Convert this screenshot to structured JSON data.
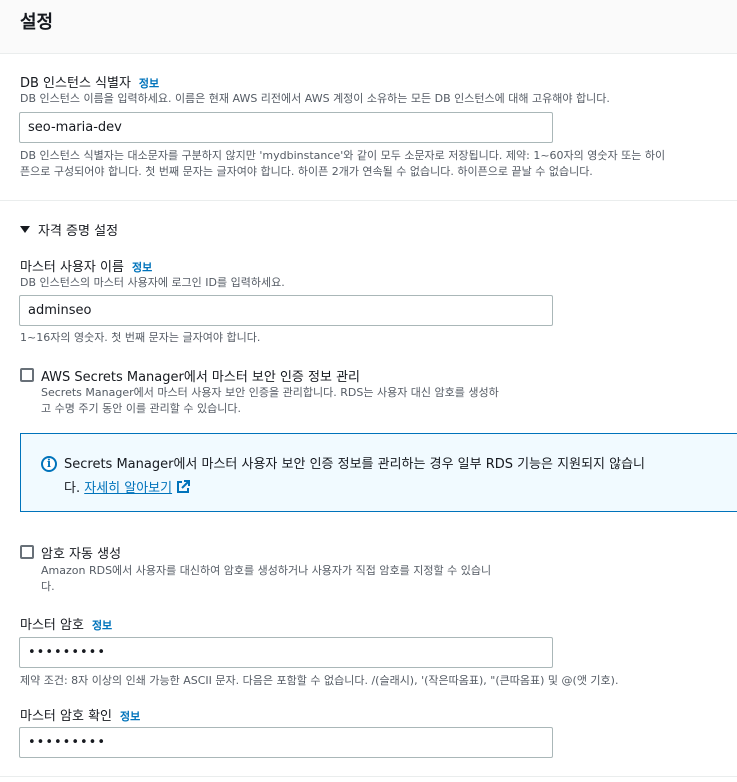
{
  "header": {
    "title": "설정"
  },
  "db_identifier": {
    "label": "DB 인스턴스 식별자",
    "info": "정보",
    "hint": "DB 인스턴스 이름을 입력하세요. 이름은 현재 AWS 리전에서 AWS 계정이 소유하는 모든 DB 인스턴스에 대해 고유해야 합니다.",
    "value": "seo-maria-dev",
    "constraint_line1": "DB 인스턴스 식별자는 대소문자를 구분하지 않지만 'mydbinstance'와 같이 모두 소문자로 저장됩니다. 제약: 1~60자의 영숫자 또는 하이",
    "constraint_line2": "픈으로 구성되어야 합니다. 첫 번째 문자는 글자여야 합니다. 하이픈 2개가 연속될 수 없습니다. 하이픈으로 끝날 수 없습니다."
  },
  "credentials": {
    "section_title": "자격 증명 설정",
    "master_username": {
      "label": "마스터 사용자 이름",
      "info": "정보",
      "hint": "DB 인스턴스의 마스터 사용자에 로그인 ID를 입력하세요.",
      "value": "adminseo",
      "constraint": "1~16자의 영숫자. 첫 번째 문자는 글자여야 합니다."
    },
    "secrets_manager": {
      "checked": false,
      "label": "AWS Secrets Manager에서 마스터 보안 인증 정보 관리",
      "desc_line1": "Secrets Manager에서 마스터 사용자 보안 인증을 관리합니다. RDS는 사용자 대신 암호를 생성하",
      "desc_line2": "고 수명 주기 동안 이를 관리할 수 있습니다."
    },
    "alert": {
      "text_line1": "Secrets Manager에서 마스터 사용자 보안 인증 정보를 관리하는 경우 일부 RDS 기능은 지원되지 않습니",
      "text_prefix": "다.",
      "link": "자세히 알아보기"
    },
    "auto_generate": {
      "checked": false,
      "label": "암호 자동 생성",
      "desc_line1": "Amazon RDS에서 사용자를 대신하여 암호를 생성하거나 사용자가 직접 암호를 지정할 수 있습니",
      "desc_line2": "다."
    },
    "master_password": {
      "label": "마스터 암호",
      "info": "정보",
      "value": "•••••••••",
      "constraint": "제약 조건: 8자 이상의 인쇄 가능한 ASCII 문자. 다음은 포함할 수 없습니다. /(슬래시), '(작은따옴표), \"(큰따옴표) 및 @(앳 기호)."
    },
    "confirm_password": {
      "label": "마스터 암호 확인",
      "info": "정보",
      "value": "•••••••••"
    }
  },
  "colors": {
    "link": "#0073bb",
    "alert_bg": "#f1faff",
    "text": "#16191f",
    "muted": "#545b64"
  }
}
